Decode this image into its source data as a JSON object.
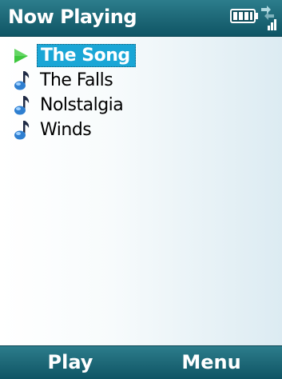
{
  "window": {
    "title": "Now Playing"
  },
  "status": {
    "battery_icon": "battery-full-icon",
    "signal_icon": "signal-strength-icon"
  },
  "playlist": {
    "tracks": [
      {
        "title": "The Song",
        "icon": "play-arrow-icon",
        "selected": true,
        "playing": true
      },
      {
        "title": "The Falls",
        "icon": "music-note-icon",
        "selected": false,
        "playing": false
      },
      {
        "title": "Nolstalgia",
        "icon": "music-note-icon",
        "selected": false,
        "playing": false
      },
      {
        "title": "Winds",
        "icon": "music-note-icon",
        "selected": false,
        "playing": false
      }
    ]
  },
  "softkeys": {
    "left_label": "Play",
    "right_label": "Menu"
  },
  "colors": {
    "bar_accent": "#1f6a79",
    "selection": "#1aa6d6",
    "play_arrow": "#3ec73e"
  }
}
